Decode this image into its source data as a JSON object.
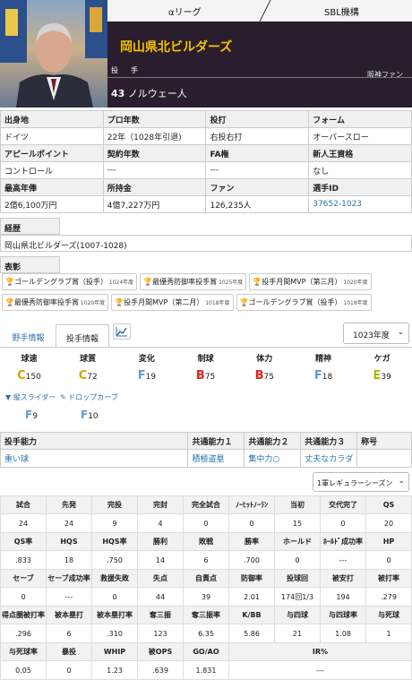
{
  "header": {
    "league": "αリーグ",
    "org": "SBL機構",
    "team": "岡山県北ビルダーズ",
    "position": "投　手",
    "fan_team": "阪神ファン",
    "number": "43",
    "nationality": "ノルウェー人"
  },
  "profile": [
    [
      {
        "l": "出身地",
        "v": "ドイツ"
      },
      {
        "l": "プロ年数",
        "v": "22年（1028年引退)"
      },
      {
        "l": "投打",
        "v": "右投右打"
      },
      {
        "l": "フォーム",
        "v": "オーバースロー"
      }
    ],
    [
      {
        "l": "アピールポイント",
        "v": "コントロール"
      },
      {
        "l": "契約年数",
        "v": "---"
      },
      {
        "l": "FA権",
        "v": "---"
      },
      {
        "l": "新人王資格",
        "v": "なし"
      }
    ],
    [
      {
        "l": "最高年俸",
        "v": "2億6,100万円"
      },
      {
        "l": "所持金",
        "v": "4億7,227万円"
      },
      {
        "l": "ファン",
        "v": "126,235人"
      },
      {
        "l": "選手ID",
        "v": "37652-1023"
      }
    ]
  ],
  "career": {
    "label": "経歴",
    "value": "岡山県北ビルダーズ(1007-1028)"
  },
  "awards": {
    "label": "表彰",
    "items": [
      {
        "name": "ゴールデングラブ賞（投手）",
        "year": "1024年度"
      },
      {
        "name": "最優秀防御率投手賞",
        "year": "1025年度"
      },
      {
        "name": "投手月間MVP（第三月）",
        "year": "1020年度"
      },
      {
        "name": "最優秀防御率投手賞",
        "year": "1020年度"
      },
      {
        "name": "投手月間MVP（第二月）",
        "year": "1018年度"
      },
      {
        "name": "ゴールデングラブ賞（投手）",
        "year": "1018年度"
      }
    ]
  },
  "tabs": {
    "fielder": "野手情報",
    "pitcher": "投手情報",
    "year": "1023年度"
  },
  "abilities": [
    {
      "label": "球速",
      "rank": "C",
      "value": "150",
      "color": "#e0a000"
    },
    {
      "label": "球質",
      "rank": "C",
      "value": "72",
      "color": "#e0a000"
    },
    {
      "label": "変化",
      "rank": "F",
      "value": "19",
      "color": "#5a9fd8"
    },
    {
      "label": "制球",
      "rank": "B",
      "value": "75",
      "color": "#e02020"
    },
    {
      "label": "体力",
      "rank": "B",
      "value": "75",
      "color": "#e02020"
    },
    {
      "label": "精神",
      "rank": "F",
      "value": "18",
      "color": "#5a9fd8"
    },
    {
      "label": "ケガ",
      "rank": "E",
      "value": "39",
      "color": "#a8b800"
    }
  ],
  "pitches": [
    {
      "name": "縦スライダー",
      "rank": "F",
      "value": "9"
    },
    {
      "name": "ドロップカーブ",
      "rank": "F",
      "value": "10"
    }
  ],
  "skills": {
    "headers": [
      "投手能力",
      "共通能力１",
      "共通能力２",
      "共通能力３",
      "称号"
    ],
    "values": [
      "重い球",
      "積極盗塁",
      "集中力○",
      "丈夫なカラダ",
      ""
    ]
  },
  "season": "1軍レギュラーシーズン",
  "stats": [
    {
      "h": [
        "試合",
        "先発",
        "完投",
        "完封",
        "完全試合",
        "ﾉｰﾋｯﾄﾉｰﾗﾝ",
        "当初",
        "交代完了",
        "QS"
      ],
      "v": [
        "24",
        "24",
        "9",
        "4",
        "0",
        "0",
        "15",
        "0",
        "20"
      ]
    },
    {
      "h": [
        "QS率",
        "HQS",
        "HQS率",
        "勝利",
        "敗戦",
        "勝率",
        "ホールド",
        "ﾎｰﾙﾄﾞ成功率",
        "HP"
      ],
      "v": [
        ".833",
        "18",
        ".750",
        "14",
        "6",
        ".700",
        "0",
        "---",
        "0"
      ]
    },
    {
      "h": [
        "セーブ",
        "セーブ成功率",
        "救援失敗",
        "失点",
        "自責点",
        "防御率",
        "投球回",
        "被安打",
        "被打率"
      ],
      "v": [
        "0",
        "---",
        "0",
        "44",
        "39",
        "2.01",
        "174回1/3",
        "194",
        ".279"
      ]
    },
    {
      "h": [
        "得点圏被打率",
        "被本塁打",
        "被本塁打率",
        "奪三振",
        "奪三振率",
        "K/BB",
        "与四球",
        "与四球率",
        "与死球"
      ],
      "v": [
        ".296",
        "6",
        ".310",
        "123",
        "6.35",
        "5.86",
        "21",
        "1.08",
        "1"
      ]
    },
    {
      "h": [
        "与死球率",
        "暴投",
        "WHIP",
        "被OPS",
        "GO/AO",
        "IR%"
      ],
      "v": [
        "0.05",
        "0",
        "1.23",
        ".639",
        "1.831",
        "---"
      ]
    }
  ]
}
